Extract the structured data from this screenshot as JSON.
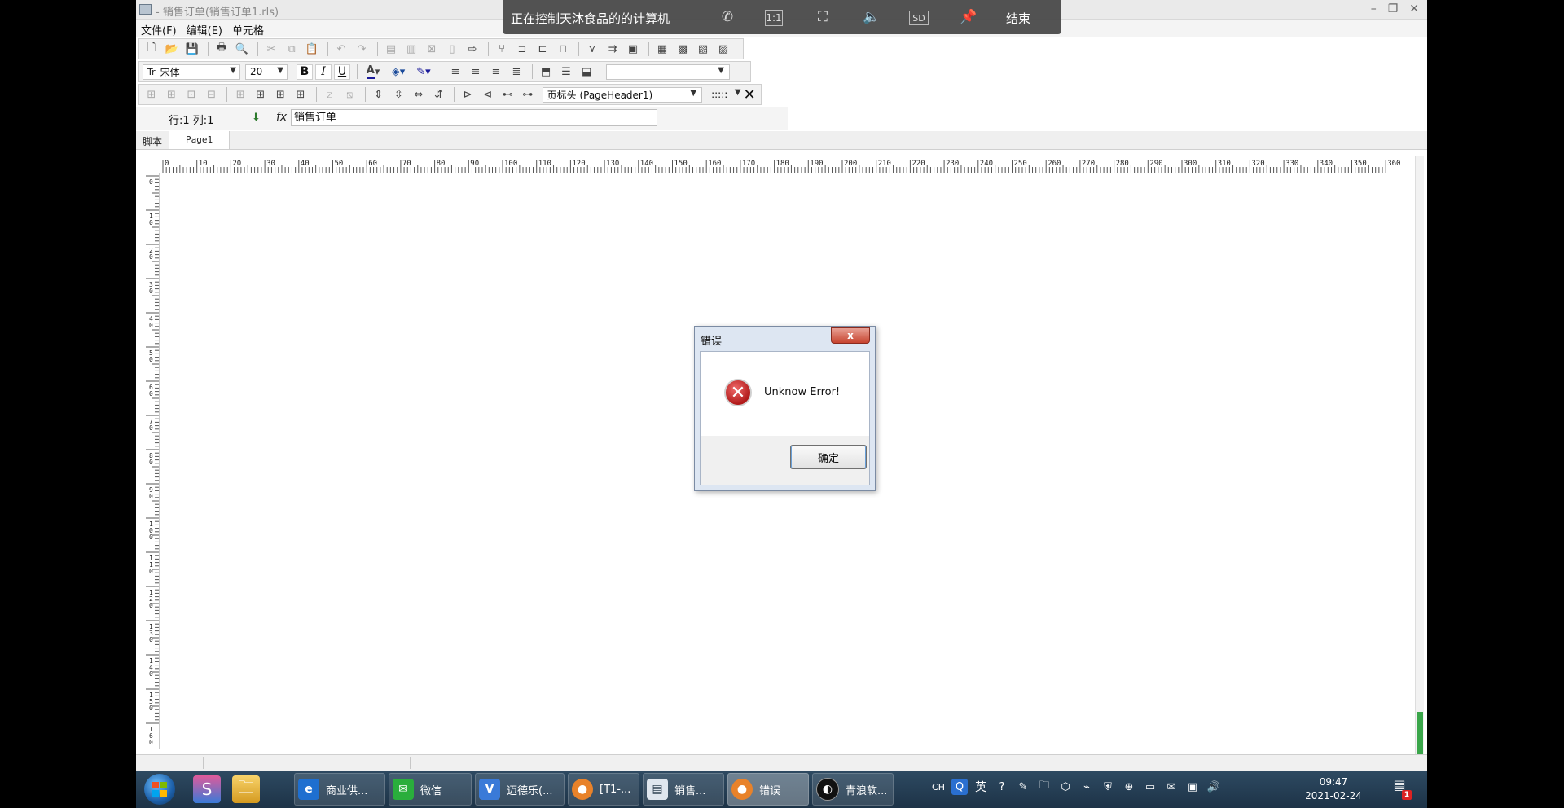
{
  "window": {
    "title": "- 销售订单(销售订单1.rls)"
  },
  "menu": [
    "文件(F)",
    "编辑(E)",
    "单元格"
  ],
  "format_toolbar": {
    "font_name": "宋体",
    "font_size": "20",
    "bold": "B",
    "italic": "I",
    "underline": "U"
  },
  "band_toolbar": {
    "band_select": "页标头 (PageHeader1)",
    "line_style": ":::::"
  },
  "formula_bar": {
    "cell_ref": "行:1 列:1",
    "fx": "fx",
    "content": "销售订单"
  },
  "sheet_tabs": [
    "脚本",
    "Page1"
  ],
  "hruler_labels": [
    "0",
    "10",
    "20",
    "30",
    "40",
    "50",
    "60",
    "70",
    "80",
    "90",
    "100",
    "110",
    "120",
    "130",
    "140",
    "150",
    "160",
    "170",
    "180",
    "190",
    "200",
    "210",
    "220",
    "230",
    "240",
    "250",
    "260",
    "270",
    "280",
    "290",
    "300",
    "310",
    "320",
    "330",
    "340",
    "350",
    "360"
  ],
  "vruler_labels": [
    "0",
    "10",
    "20",
    "30",
    "40",
    "50",
    "60",
    "70",
    "80",
    "90",
    "100",
    "110",
    "120",
    "130",
    "140",
    "150",
    "160"
  ],
  "remote_control": {
    "title": "正在控制天沐食品的的计算机",
    "ratio_label": "1:1",
    "quality_label": "SD",
    "end_label": "结束"
  },
  "dialog": {
    "title": "错误",
    "message": "Unknow Error!",
    "ok_label": "确定",
    "close_glyph": "x"
  },
  "taskbar": {
    "tasks": [
      {
        "label": "商业供...",
        "icon": "ie-icon"
      },
      {
        "label": "微信",
        "icon": "wechat-icon"
      },
      {
        "label": "迈德乐(...",
        "icon": "vs-icon"
      },
      {
        "label": "[T1-...",
        "icon": "app-icon"
      },
      {
        "label": "销售...",
        "icon": "report-icon"
      },
      {
        "label": "错误",
        "icon": "error-app-icon"
      },
      {
        "label": "青浪软...",
        "icon": "qinglang-icon"
      }
    ],
    "ime": "CH",
    "lang": "英",
    "time": "09:47",
    "date": "2021-02-24",
    "notify_count": "1"
  }
}
